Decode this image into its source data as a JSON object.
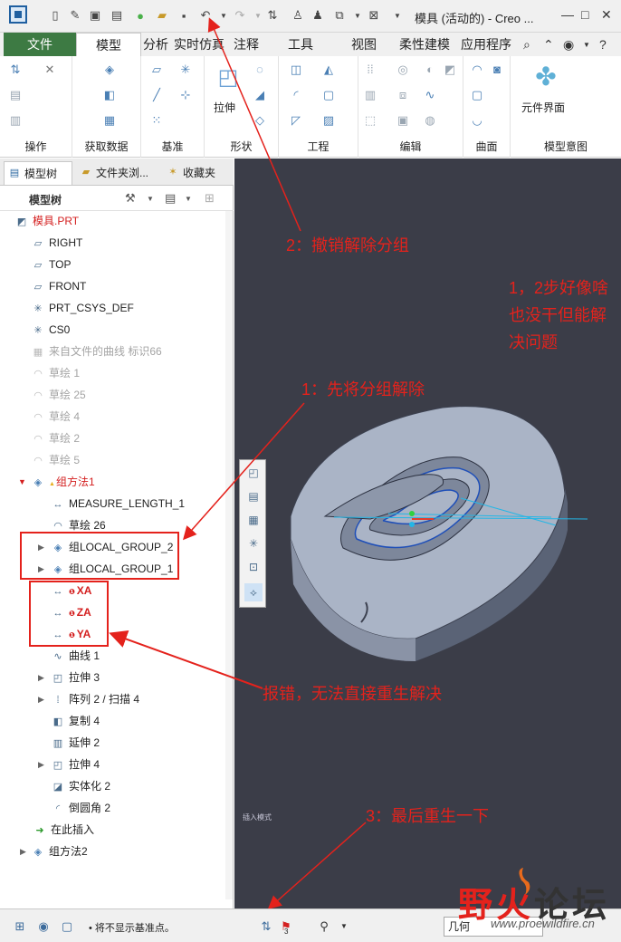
{
  "window": {
    "title": "模具 (活动的) - Creo ...",
    "controls": {
      "minimize": "—",
      "maximize": "□",
      "close": "✕"
    }
  },
  "tabs": [
    {
      "label": "文件"
    },
    {
      "label": "模型"
    },
    {
      "label": "分析"
    },
    {
      "label": "实时仿真"
    },
    {
      "label": "注释"
    },
    {
      "label": "工具"
    },
    {
      "label": "视图"
    },
    {
      "label": "柔性建模"
    },
    {
      "label": "应用程序"
    }
  ],
  "ribbon": {
    "groups": [
      {
        "label": "操作"
      },
      {
        "label": "获取数据"
      },
      {
        "label": "基准"
      },
      {
        "label": "形状"
      },
      {
        "label": "工程"
      },
      {
        "label": "编辑"
      },
      {
        "label": "曲面"
      },
      {
        "label": "模型意图"
      }
    ],
    "extrude_label": "拉伸",
    "component_interface_label": "元件界面"
  },
  "panel": {
    "tabs": [
      {
        "label": "模型树"
      },
      {
        "label": "文件夹浏..."
      },
      {
        "label": "收藏夹"
      }
    ],
    "tree_title": "模型树"
  },
  "tree": [
    {
      "label": "模具.PRT",
      "icon": "part-icon",
      "style": "redlight"
    },
    {
      "label": "RIGHT",
      "icon": "datum-plane-icon",
      "style": ""
    },
    {
      "label": "TOP",
      "icon": "datum-plane-icon",
      "style": ""
    },
    {
      "label": "FRONT",
      "icon": "datum-plane-icon",
      "style": ""
    },
    {
      "label": "PRT_CSYS_DEF",
      "icon": "csys-icon",
      "style": ""
    },
    {
      "label": "CS0",
      "icon": "csys-icon",
      "style": ""
    },
    {
      "label": "来自文件的曲线 标识66",
      "icon": "curve-file-icon",
      "style": "dim"
    },
    {
      "label": "草绘 1",
      "icon": "sketch-icon",
      "style": "dim"
    },
    {
      "label": "草绘 25",
      "icon": "sketch-icon",
      "style": "dim"
    },
    {
      "label": "草绘 4",
      "icon": "sketch-icon",
      "style": "dim"
    },
    {
      "label": "草绘 2",
      "icon": "sketch-icon",
      "style": "dim"
    },
    {
      "label": "草绘 5",
      "icon": "sketch-icon",
      "style": "dim"
    },
    {
      "label": "组方法1",
      "icon": "group-icon",
      "style": "redlight"
    },
    {
      "label": "MEASURE_LENGTH_1",
      "icon": "measure-icon",
      "style": ""
    },
    {
      "label": "草绘 26",
      "icon": "sketch-icon",
      "style": ""
    },
    {
      "label": "组LOCAL_GROUP_2",
      "icon": "group-icon",
      "style": ""
    },
    {
      "label": "组LOCAL_GROUP_1",
      "icon": "group-icon",
      "style": ""
    },
    {
      "label": "XA",
      "icon": "measure-icon",
      "style": "red"
    },
    {
      "label": "ZA",
      "icon": "measure-icon",
      "style": "red"
    },
    {
      "label": "YA",
      "icon": "measure-icon",
      "style": "red"
    },
    {
      "label": "曲线 1",
      "icon": "curve-icon",
      "style": ""
    },
    {
      "label": "拉伸 3",
      "icon": "extrude-icon",
      "style": ""
    },
    {
      "label": "阵列 2 / 扫描 4",
      "icon": "pattern-icon",
      "style": ""
    },
    {
      "label": "复制 4",
      "icon": "copy-icon",
      "style": ""
    },
    {
      "label": "延伸 2",
      "icon": "extend-icon",
      "style": ""
    },
    {
      "label": "拉伸 4",
      "icon": "extrude-icon",
      "style": ""
    },
    {
      "label": "实体化 2",
      "icon": "solidify-icon",
      "style": ""
    },
    {
      "label": "倒圆角 2",
      "icon": "round-icon",
      "style": ""
    },
    {
      "label": "在此插入",
      "icon": "insert-here-icon",
      "style": ""
    },
    {
      "label": "组方法2",
      "icon": "group-icon",
      "style": ""
    }
  ],
  "annotations": {
    "step2": "2：撤销解除分组",
    "note": "1，2步好像啥也没干但能解决问题",
    "step1": "1：先将分组解除",
    "error": "报错，无法直接重生解决",
    "step3": "3：最后重生一下"
  },
  "graphics": {
    "small_label": "插入模式"
  },
  "status": {
    "message": "• 将不显示基准点。",
    "regen_count": "3",
    "filter_value": "几何"
  },
  "watermark": {
    "text": "野火论坛",
    "url": "www.proewildfire.cn"
  },
  "colors": {
    "annotation_red": "#e4221c",
    "file_tab_green": "#3d7a43",
    "graphics_bg": "#3b3d48",
    "model_face": "#aab4c6"
  }
}
